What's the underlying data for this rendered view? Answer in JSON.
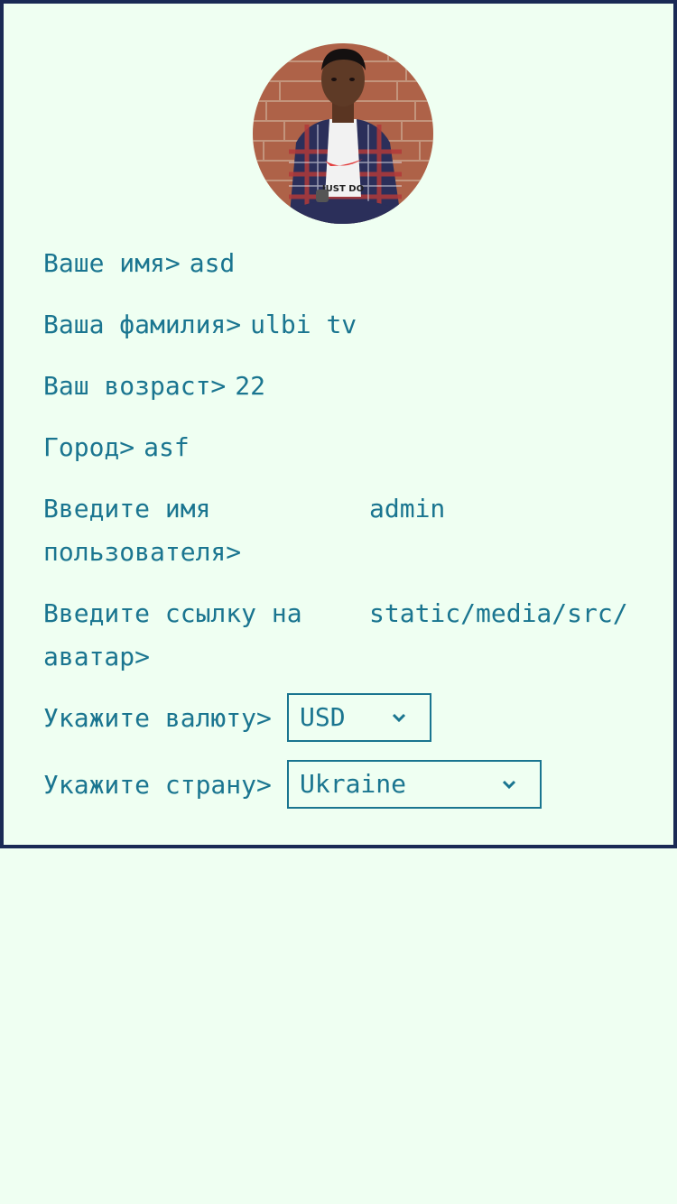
{
  "profile": {
    "avatar_alt": "avatar",
    "fields": [
      {
        "label": "Ваше имя>",
        "value": "asd"
      },
      {
        "label": "Ваша фамилия>",
        "value": "ulbi tv"
      },
      {
        "label": "Ваш возраст>",
        "value": "22"
      },
      {
        "label": "Город>",
        "value": "asf"
      },
      {
        "label": "Введите имя пользователя>",
        "value": "admin"
      },
      {
        "label": "Введите ссылку на аватар>",
        "value": "static/media/src/"
      }
    ],
    "currency": {
      "label": "Укажите валюту>",
      "value": "USD"
    },
    "country": {
      "label": "Укажите страну>",
      "value": "Ukraine"
    }
  },
  "icons": {
    "dropdown": "chevron-down-icon",
    "avatar": "user-photo"
  }
}
